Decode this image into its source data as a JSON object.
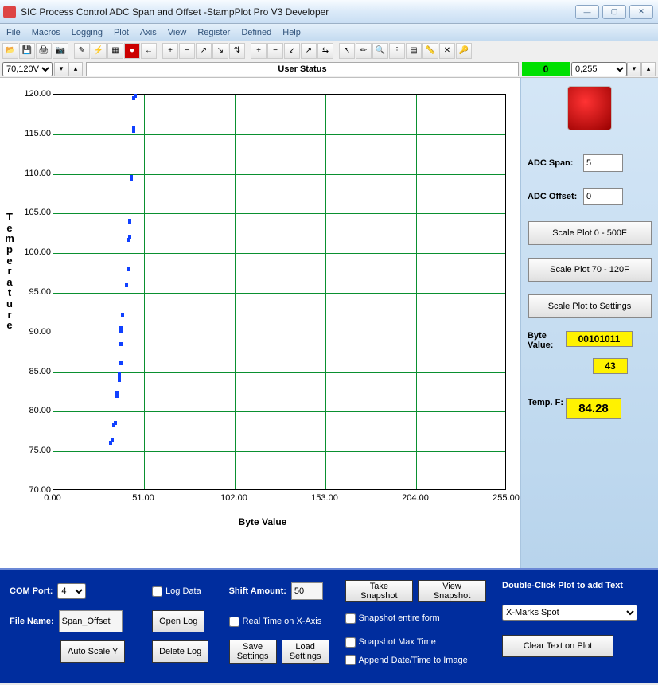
{
  "window": {
    "title": "SIC Process Control ADC Span and Offset -StampPlot Pro V3 Developer"
  },
  "menu": {
    "file": "File",
    "macros": "Macros",
    "logging": "Logging",
    "plot": "Plot",
    "axis": "Axis",
    "view": "View",
    "register": "Register",
    "defined": "Defined",
    "help": "Help"
  },
  "status": {
    "y_range": "70,120V",
    "user_status_label": "User Status",
    "counter": "0",
    "x_range": "0,255"
  },
  "chart_data": {
    "type": "scatter",
    "xlabel": "Byte Value",
    "ylabel": "Temperature",
    "xlim": [
      0,
      255
    ],
    "ylim": [
      70,
      120
    ],
    "xticks": [
      0.0,
      51.0,
      102.0,
      153.0,
      204.0,
      255.0
    ],
    "yticks": [
      70.0,
      75.0,
      80.0,
      85.0,
      90.0,
      95.0,
      100.0,
      105.0,
      110.0,
      115.0,
      120.0
    ],
    "series": [
      {
        "name": "temp",
        "points": [
          [
            32,
            76.1
          ],
          [
            33,
            76.5
          ],
          [
            34,
            78.3
          ],
          [
            35,
            78.6
          ],
          [
            36,
            82.0
          ],
          [
            36,
            82.4
          ],
          [
            37,
            84.1
          ],
          [
            37,
            84.5
          ],
          [
            37,
            84.8
          ],
          [
            38,
            86.2
          ],
          [
            38,
            88.6
          ],
          [
            38,
            90.2
          ],
          [
            38,
            90.6
          ],
          [
            39,
            92.3
          ],
          [
            41,
            96.0
          ],
          [
            42,
            98.0
          ],
          [
            42,
            101.7
          ],
          [
            43,
            102.0
          ],
          [
            43,
            103.9
          ],
          [
            43,
            104.1
          ],
          [
            44,
            109.4
          ],
          [
            44,
            109.7
          ],
          [
            45,
            115.5
          ],
          [
            45,
            115.9
          ],
          [
            45,
            119.6
          ],
          [
            46,
            119.9
          ]
        ]
      }
    ]
  },
  "right": {
    "adc_span_label": "ADC Span:",
    "adc_span": "5",
    "adc_offset_label": "ADC Offset:",
    "adc_offset": "0",
    "btn_scale_0_500": "Scale Plot 0 - 500F",
    "btn_scale_70_120": "Scale Plot 70 - 120F",
    "btn_scale_settings": "Scale Plot to Settings",
    "byte_value_label": "Byte Value:",
    "byte_bin": "00101011",
    "byte_dec": "43",
    "temp_label": "Temp. F:",
    "temp_val": "84.28"
  },
  "bottom": {
    "com_port_label": "COM Port:",
    "com_port": "4",
    "file_name_label": "File Name:",
    "file_name": "Span_Offset",
    "log_data": "Log Data",
    "open_log": "Open Log",
    "auto_scale_y": "Auto Scale Y",
    "delete_log": "Delete Log",
    "shift_amount_label": "Shift Amount:",
    "shift_amount": "50",
    "real_time": "Real Time on X-Axis",
    "save_settings": "Save Settings",
    "load_settings": "Load Settings",
    "take_snapshot": "Take Snapshot",
    "view_snapshot": "View Snapshot",
    "snapshot_form": "Snapshot entire form",
    "snapshot_max": "Snapshot Max Time",
    "append_dt": "Append Date/Time to Image",
    "dbl_click": "Double-Click Plot to add Text",
    "xmarks": "X-Marks Spot",
    "clear_text": "Clear Text on Plot"
  }
}
